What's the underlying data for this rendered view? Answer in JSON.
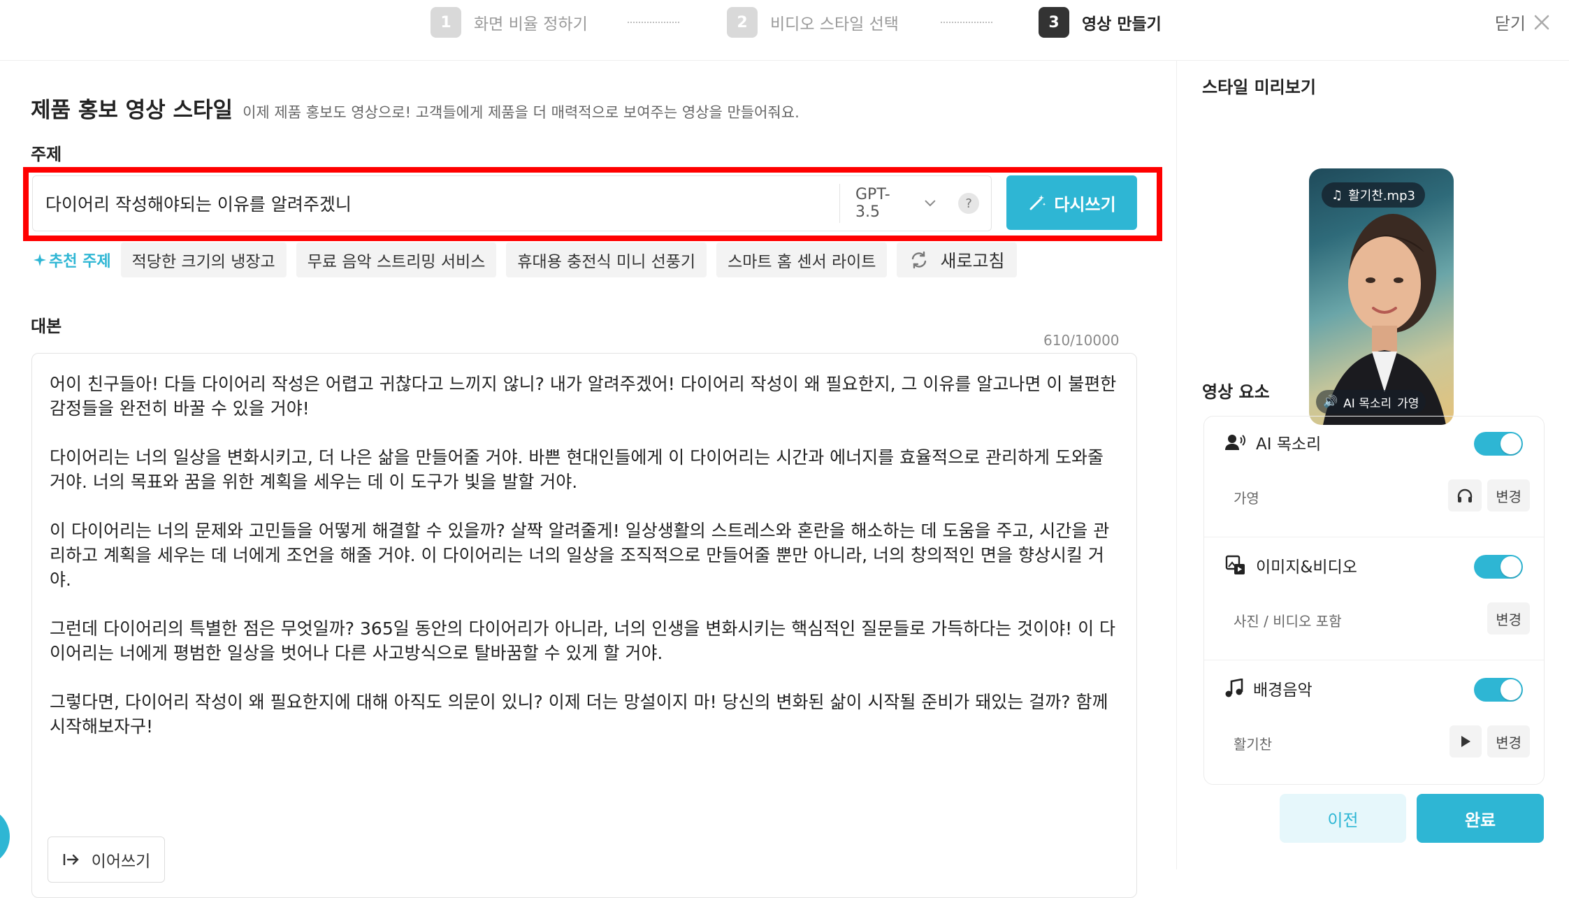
{
  "stepper": {
    "steps": [
      {
        "num": "1",
        "label": "화면 비율 정하기"
      },
      {
        "num": "2",
        "label": "비디오 스타일 선택"
      },
      {
        "num": "3",
        "label": "영상 만들기"
      }
    ],
    "close_label": "닫기"
  },
  "main": {
    "title": "제품 홍보 영상 스타일",
    "description": "이제 제품 홍보도 영상으로! 고객들에게 제품을 더 매력적으로 보여주는 영상을 만들어줘요.",
    "topic_label": "주제",
    "topic_value": "다이어리 작성해야되는 이유를 알려주겠니",
    "model": "GPT-3.5",
    "help": "?",
    "rewrite_label": "다시쓰기",
    "recommend_label": "추천 주제",
    "recommendations": [
      "적당한 크기의 냉장고",
      "무료 음악 스트리밍 서비스",
      "휴대용 충전식 미니 선풍기",
      "스마트 홈 센서 라이트"
    ],
    "refresh_label": "새로고침",
    "script_label": "대본",
    "char_count": "610/10000",
    "script_paragraphs": [
      "어이 친구들아! 다들 다이어리 작성은 어렵고 귀찮다고 느끼지 않니? 내가 알려주겠어! 다이어리 작성이 왜 필요한지, 그 이유를 알고나면 이 불편한 감정들을 완전히 바꿀 수 있을 거야!",
      "다이어리는 너의 일상을 변화시키고, 더 나은 삶을 만들어줄 거야. 바쁜 현대인들에게 이 다이어리는 시간과 에너지를 효율적으로 관리하게 도와줄 거야. 너의 목표와 꿈을 위한 계획을 세우는 데 이 도구가 빛을 발할 거야.",
      "이 다이어리는 너의 문제와 고민들을 어떻게 해결할 수 있을까? 살짝 알려줄게! 일상생활의 스트레스와 혼란을 해소하는 데 도움을 주고, 시간을 관리하고 계획을 세우는 데 너에게 조언을 해줄 거야. 이 다이어리는 너의 일상을 조직적으로 만들어줄 뿐만 아니라, 너의 창의적인 면을 향상시킬 거야.",
      "그런데 다이어리의 특별한 점은 무엇일까? 365일 동안의 다이어리가 아니라, 너의 인생을 변화시키는 핵심적인 질문들로 가득하다는 것이야! 이 다이어리는 너에게 평범한 일상을 벗어나 다른 사고방식으로 탈바꿈할 수 있게 할 거야.",
      "그렇다면, 다이어리 작성이 왜 필요한지에 대해 아직도 의문이 있니? 이제 더는 망설이지 마! 당신의 변화된 삶이 시작될 준비가 돼있는 걸까? 함께 시작해보자구!"
    ],
    "continue_label": "이어쓰기"
  },
  "side": {
    "preview_title": "스타일 미리보기",
    "music_file": "활기찬.mp3",
    "voice_badge_label": "AI 목소리",
    "voice_badge_name": "가영",
    "elements_title": "영상 요소",
    "elements": [
      {
        "name": "AI 목소리",
        "sub": "가영",
        "action": "변경"
      },
      {
        "name": "이미지&비디오",
        "sub": "사진 / 비디오 포함",
        "action": "변경"
      },
      {
        "name": "배경음악",
        "sub": "활기찬",
        "action": "변경"
      }
    ],
    "prev_label": "이전",
    "done_label": "완료"
  },
  "colors": {
    "accent": "#2eb6d4",
    "highlight": "#ff0000"
  }
}
